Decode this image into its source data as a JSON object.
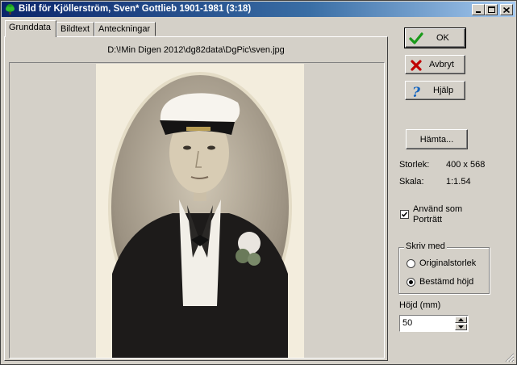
{
  "window": {
    "title": "Bild för Kjöllerström, Sven* Gottlieb 1901-1981 (3:18)",
    "controls": [
      "minimize-icon",
      "maximize-icon",
      "close-icon"
    ]
  },
  "tabs": [
    {
      "label": "Grunddata",
      "active": true
    },
    {
      "label": "Bildtext",
      "active": false
    },
    {
      "label": "Anteckningar",
      "active": false
    }
  ],
  "image": {
    "path": "D:\\!Min Digen 2012\\dg82data\\DgPic\\sven.jpg"
  },
  "buttons": {
    "ok": "OK",
    "cancel": "Avbryt",
    "help": "Hjälp",
    "fetch": "Hämta..."
  },
  "info": {
    "size_label": "Storlek:",
    "size_value": "400 x 568",
    "scale_label": "Skala:",
    "scale_value": "1:1.54"
  },
  "portrait": {
    "label": "Använd som Porträtt",
    "checked": true
  },
  "print_with": {
    "label": "Skriv med",
    "options": [
      {
        "label": "Originalstorlek",
        "selected": false
      },
      {
        "label": "Bestämd höjd",
        "selected": true
      }
    ]
  },
  "height": {
    "label": "Höjd (mm)",
    "value": "50"
  },
  "colors": {
    "title_start": "#0a246a",
    "title_end": "#a6caf0",
    "ok_check": "#1a9a1a",
    "cancel_x": "#c00000",
    "help_q": "#1565c0"
  }
}
